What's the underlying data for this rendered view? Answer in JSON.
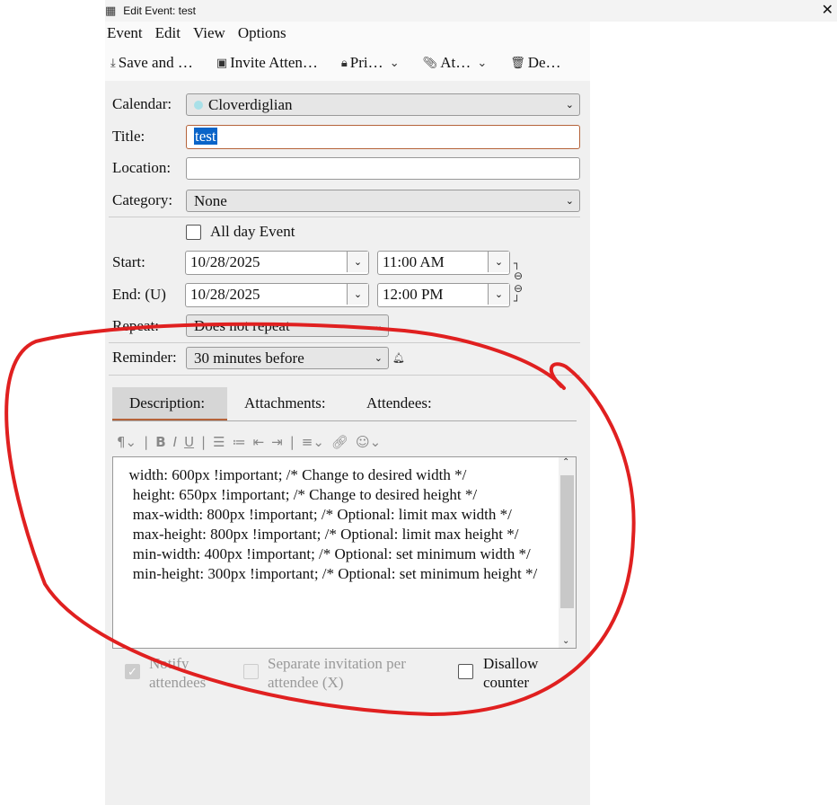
{
  "window": {
    "title": "Edit Event: test"
  },
  "menu": [
    "Event",
    "Edit",
    "View",
    "Options"
  ],
  "toolbar": {
    "save": "Save and …",
    "invite": "Invite Atten…",
    "privacy": "Pri…",
    "attach": "At…",
    "delete": "De…"
  },
  "form": {
    "calendar_label": "Calendar:",
    "calendar_value": "Cloverdiglian",
    "calendar_color": "#a8e0e8",
    "title_label": "Title:",
    "title_value": "test",
    "location_label": "Location:",
    "location_value": "",
    "category_label": "Category:",
    "category_value": "None",
    "allday_label": "All day Event",
    "allday_checked": false,
    "start_label": "Start:",
    "start_date": "10/28/2025",
    "start_time": "11:00 AM",
    "end_label": "End: (U)",
    "end_date": "10/28/2025",
    "end_time": "12:00 PM",
    "repeat_label": "Repeat:",
    "repeat_value": "Does not repeat",
    "reminder_label": "Reminder:",
    "reminder_value": "30 minutes before"
  },
  "tabs": [
    "Description:",
    "Attachments:",
    "Attendees:"
  ],
  "description": "  width: 600px !important; /* Change to desired width */\n   height: 650px !important; /* Change to desired height */\n   max-width: 800px !important; /* Optional: limit max width */\n   max-height: 800px !important; /* Optional: limit max height */\n   min-width: 400px !important; /* Optional: set minimum width */\n   min-height: 300px !important; /* Optional: set minimum height */",
  "options": {
    "notify": "Notify attendees",
    "notify_checked": true,
    "separate": "Separate invitation per attendee (X)",
    "separate_checked": false,
    "disallow": "Disallow counter",
    "disallow_checked": false
  },
  "annotation_color": "#e02020"
}
